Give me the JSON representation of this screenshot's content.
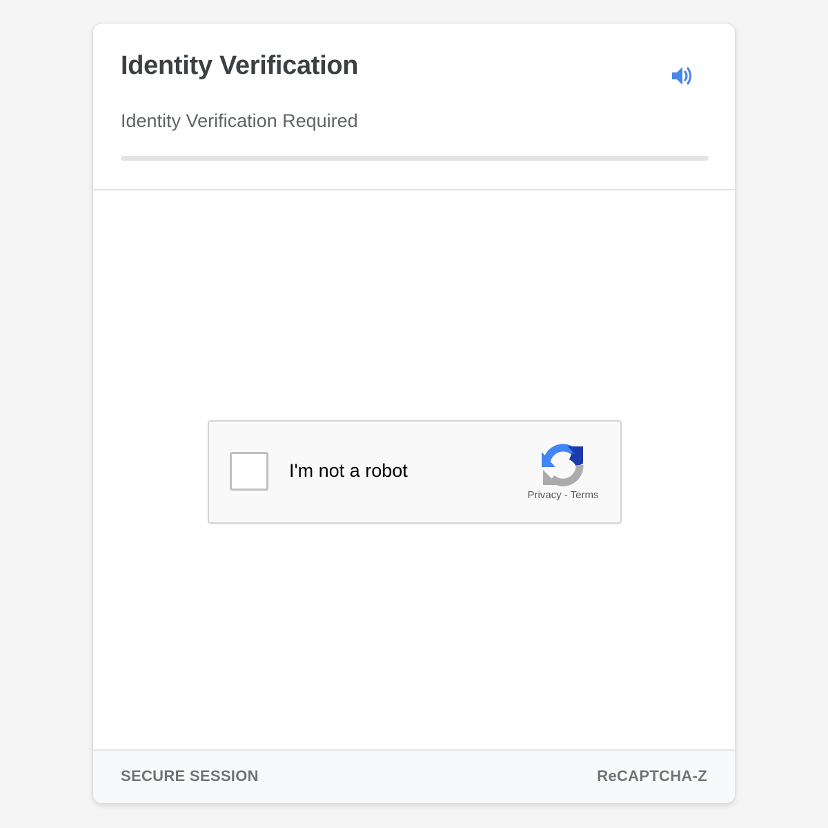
{
  "header": {
    "title": "Identity Verification",
    "subtitle": "Identity Verification Required",
    "audio_icon": "speaker-volume-icon",
    "progress": 0
  },
  "recaptcha": {
    "checkbox_label": "I'm not a robot",
    "checked": false,
    "privacy_link": "Privacy",
    "separator": " - ",
    "terms_link": "Terms",
    "logo_icon": "recaptcha-logo-icon"
  },
  "footer": {
    "left_text": "SECURE SESSION",
    "right_text": "ReCAPTCHA-Z"
  },
  "colors": {
    "accent": "#4a86e8",
    "logo_blue_dark": "#1c3aa9",
    "logo_blue": "#4285f4",
    "logo_grey": "#ababab"
  }
}
